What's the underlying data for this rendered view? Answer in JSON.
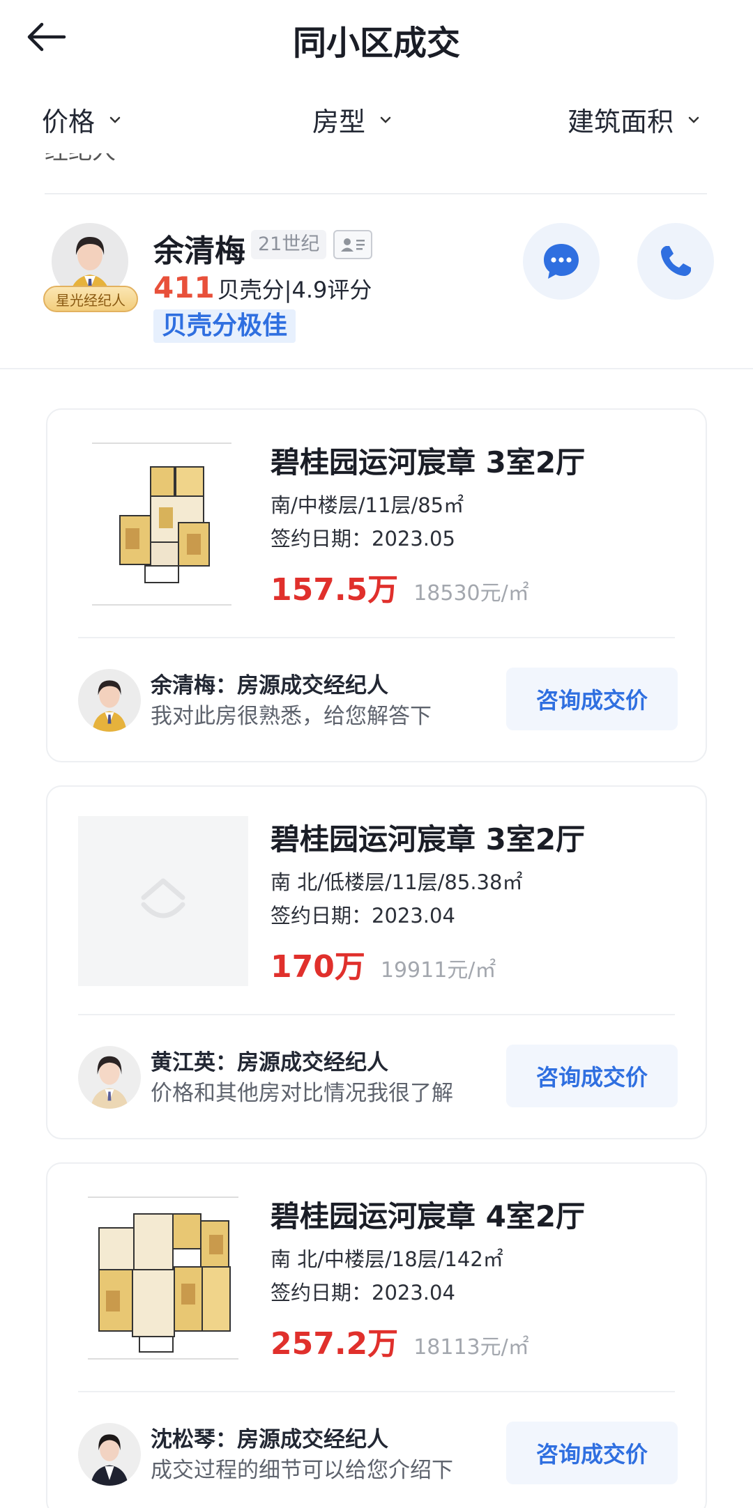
{
  "header": {
    "title": "同小区成交"
  },
  "filters": [
    {
      "label": "价格"
    },
    {
      "label": "房型"
    },
    {
      "label": "建筑面积"
    }
  ],
  "clipped_text": "经纪人",
  "agent": {
    "name": "余清梅",
    "company": "21世纪",
    "badge": "星光经纪人",
    "score_value": "411",
    "score_text": "贝壳分|4.9评分",
    "score_tag": "贝壳分极佳"
  },
  "listings": [
    {
      "title": "碧桂园运河宸章 3室2厅",
      "detail": "南/中楼层/11层/85㎡",
      "date": "签约日期：2023.05",
      "price": "157.5万",
      "unit_price": "18530元/㎡",
      "image": "floorplan",
      "agent_title": "余清梅：房源成交经纪人",
      "agent_desc": "我对此房很熟悉，给您解答下",
      "button": "咨询成交价"
    },
    {
      "title": "碧桂园运河宸章 3室2厅",
      "detail": "南 北/低楼层/11层/85.38㎡",
      "date": "签约日期：2023.04",
      "price": "170万",
      "unit_price": "19911元/㎡",
      "image": "placeholder",
      "agent_title": "黄江英：房源成交经纪人",
      "agent_desc": "价格和其他房对比情况我很了解",
      "button": "咨询成交价"
    },
    {
      "title": "碧桂园运河宸章 4室2厅",
      "detail": "南 北/中楼层/18层/142㎡",
      "date": "签约日期：2023.04",
      "price": "257.2万",
      "unit_price": "18113元/㎡",
      "image": "floorplan",
      "agent_title": "沈松琴：房源成交经纪人",
      "agent_desc": "成交过程的细节可以给您介绍下",
      "button": "咨询成交价"
    }
  ],
  "colors": {
    "price_red": "#e0302c",
    "accent_blue": "#2f6fe0",
    "score_orange": "#e8503a"
  }
}
